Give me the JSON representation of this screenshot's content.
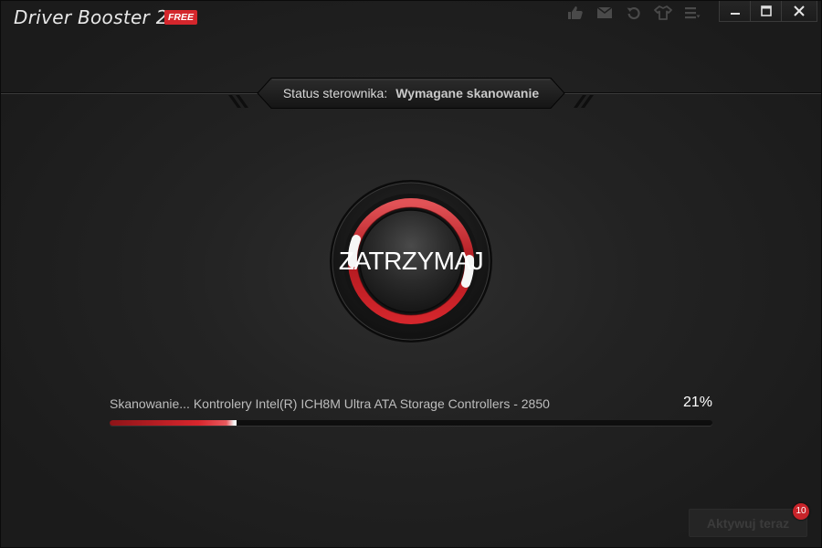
{
  "window": {
    "title": "Driver Booster 2",
    "edition_badge": "FREE"
  },
  "toolbar": {
    "icons": [
      "thumbs-up-icon",
      "mail-icon",
      "restore-icon",
      "shirt-icon",
      "menu-icon"
    ]
  },
  "window_controls": [
    "minimize-icon",
    "maximize-icon",
    "close-icon"
  ],
  "status": {
    "label": "Status sterownika:",
    "value": "Wymagane skanowanie"
  },
  "scan_button": {
    "label": "ZATRZYMAJ"
  },
  "progress": {
    "text": "Skanowanie... Kontrolery Intel(R) ICH8M Ultra ATA Storage Controllers - 2850",
    "percent_label": "21%",
    "value": 0.21
  },
  "activate": {
    "label": "Aktywuj teraz",
    "badge_count": "10"
  },
  "colors": {
    "accent": "#d4262c",
    "background": "#1f1f1f",
    "text": "#cfcfcf"
  }
}
